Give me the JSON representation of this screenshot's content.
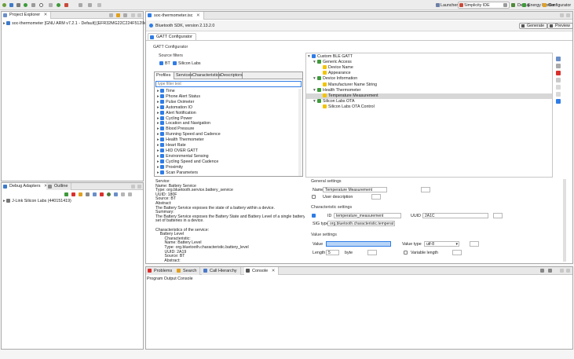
{
  "colors": {
    "blue": "#2f7ce6",
    "green": "#3e9a3a",
    "yellow": "#f2c400",
    "red": "#d9302c",
    "purple": "#6f57c8",
    "selection": "#d7d7d7"
  },
  "toolbar": {
    "launcher_label": "Launcher",
    "simplicity_ide_label": "Simplicity IDE",
    "debug_label": "Debug",
    "energy_profiler_label": "Energy Profiler",
    "configurator_label": "Configurator"
  },
  "project_explorer": {
    "title": "Project Explorer",
    "items": [
      {
        "label": "soc-thermometer [GNU ARM v7.2.1 - Default] [EFR32MG22C224F512IM40"
      }
    ]
  },
  "debug_adapters": {
    "tab_label": "Debug Adapters",
    "outline_tab_label": "Outline",
    "items": [
      {
        "label": "J-Link Silicon Labs (440151419)"
      }
    ]
  },
  "editor": {
    "tab_label": "soc-thermometer.isc",
    "sdk_label": "Bluetooth SDK, version 2.13.2.0",
    "generate_label": "Generate",
    "preview_label": "Preview",
    "gatt_tab_label": "GATT Configurator",
    "section_title": "GATT Configurator",
    "source_filters": {
      "label": "Source filters",
      "bt_label": "BT",
      "silicon_labs_label": "Silicon Labs"
    },
    "filter_tabs": [
      "Profiles",
      "Services",
      "Characteristics",
      "Descriptors"
    ],
    "filter_placeholder": "type filter text",
    "profiles": [
      "Time",
      "Phone Alert Status",
      "Pulse Oximeter",
      "Automation IO",
      "Alert Notification",
      "Cycling Power",
      "Location and Navigation",
      "Blood Pressure",
      "Running Speed and Cadence",
      "Health Thermometer",
      "Heart Rate",
      "HID OVER GATT",
      "Environmental Sensing",
      "Cycling Speed and Cadence",
      "Proximity",
      "Scan Parameters"
    ],
    "gatt_tree": [
      {
        "label": "Custom BLE GATT",
        "level": 0,
        "icon": "blue"
      },
      {
        "label": "Generic Access",
        "level": 1,
        "icon": "green"
      },
      {
        "label": "Device Name",
        "level": 2,
        "icon": "yellow"
      },
      {
        "label": "Appearance",
        "level": 2,
        "icon": "yellow"
      },
      {
        "label": "Device Information",
        "level": 1,
        "icon": "green"
      },
      {
        "label": "Manufacturer Name String",
        "level": 2,
        "icon": "yellow"
      },
      {
        "label": "Health Thermometer",
        "level": 1,
        "icon": "green"
      },
      {
        "label": "Temperature Measurement",
        "level": 2,
        "icon": "yellow",
        "selected": true
      },
      {
        "label": "Silicon Labs OTA",
        "level": 1,
        "icon": "green"
      },
      {
        "label": "Silicon Labs OTA Control",
        "level": 2,
        "icon": "yellow"
      }
    ],
    "description": [
      "Service:",
      "Name: Battery Service",
      "Type: org.bluetooth.service.battery_service",
      "UUID: 180F",
      "Source: BT",
      "Abstract:",
      "The Battery Service exposes the state of a battery within a device.",
      "Summary:",
      "The Battery Service exposes the Battery State and Battery Level of a single battery or",
      "set of batteries in a device.",
      "",
      "Characteristics of the service:",
      "    Battery Level",
      "        Characteristic:",
      "        Name: Battery Level",
      "        Type: org.bluetooth.characteristic.battery_level",
      "        UUID: 2A19",
      "        Source: BT",
      "        Abstract:"
    ],
    "general_settings": {
      "title": "General settings",
      "name_label": "Name",
      "name_value": "Temperature Measurement",
      "user_description_label": "User description"
    },
    "characteristic_settings": {
      "title": "Characteristic settings",
      "id_label": "ID",
      "id_value": "temperature_measurement",
      "uuid_label": "UUID",
      "uuid_value": "2A1C",
      "sig_type_label": "SIG type",
      "sig_type_value": "org.bluetooth.characteristic.temperat"
    },
    "value_settings": {
      "title": "Value settings",
      "value_label": "Value",
      "value_type_label": "Value type",
      "value_type_value": "utf-8",
      "length_label": "Length",
      "length_value": "5",
      "length_unit": "byte",
      "variable_length_label": "Variable length"
    }
  },
  "bottom_panel": {
    "tabs": [
      "Problems",
      "Search",
      "Call Hierarchy",
      "Console"
    ],
    "console_title": "Program Output Console"
  }
}
